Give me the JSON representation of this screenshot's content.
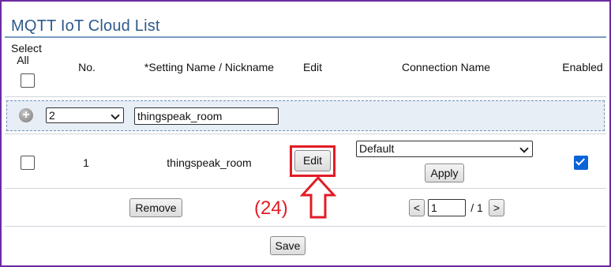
{
  "title": "MQTT IoT Cloud List",
  "header": {
    "select_all_line1": "Select",
    "select_all_line2": "All",
    "no": "No.",
    "setting_name": "*Setting Name / Nickname",
    "edit": "Edit",
    "connection_name": "Connection Name",
    "enabled": "Enabled"
  },
  "add_row": {
    "count_select_value": "2",
    "name_input_value": "thingspeak_room"
  },
  "rows": [
    {
      "no": "1",
      "setting_name": "thingspeak_room",
      "edit_label": "Edit",
      "connection_select_value": "Default",
      "apply_label": "Apply",
      "enabled": true
    }
  ],
  "footer": {
    "remove_label": "Remove",
    "prev_label": "<",
    "page_input": "1",
    "page_total": "/ 1",
    "next_label": ">",
    "save_label": "Save"
  },
  "annotation": {
    "label": "(24)"
  },
  "colors": {
    "frame": "#6a2aa3",
    "title": "#2e5a8a",
    "annotation": "#e21c26",
    "checkbox_checked": "#0a64d6"
  }
}
